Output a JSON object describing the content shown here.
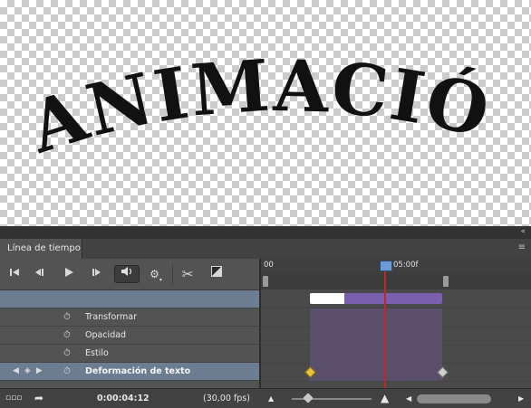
{
  "canvas": {
    "word": "ANIMACIÓN"
  },
  "panel": {
    "tab_label": "Línea de tiempo",
    "collapse_glyph": "«",
    "menu_glyph": "≡"
  },
  "controls": {
    "first_frame_icon": "first-frame-icon",
    "prev_frame_icon": "previous-frame-icon",
    "play_icon": "play-icon",
    "next_frame_icon": "next-frame-icon",
    "audio_icon": "audio-icon",
    "settings_icon": "gear-icon",
    "split_icon": "scissors-icon",
    "transition_icon": "transition-icon"
  },
  "ruler": {
    "start_label": "00",
    "playhead_label": "05:00f"
  },
  "layers": [
    {
      "label": "Transformar"
    },
    {
      "label": "Opacidad"
    },
    {
      "label": "Estilo"
    },
    {
      "label": "Deformación de texto"
    }
  ],
  "status": {
    "current_time": "0:00:04:12",
    "fps": "(30,00 fps)"
  },
  "colors": {
    "accent_track": "#7a5fae",
    "playhead": "#c0272d",
    "keyframe_active": "#e8c43a",
    "selected_row": "#6c7d91"
  }
}
